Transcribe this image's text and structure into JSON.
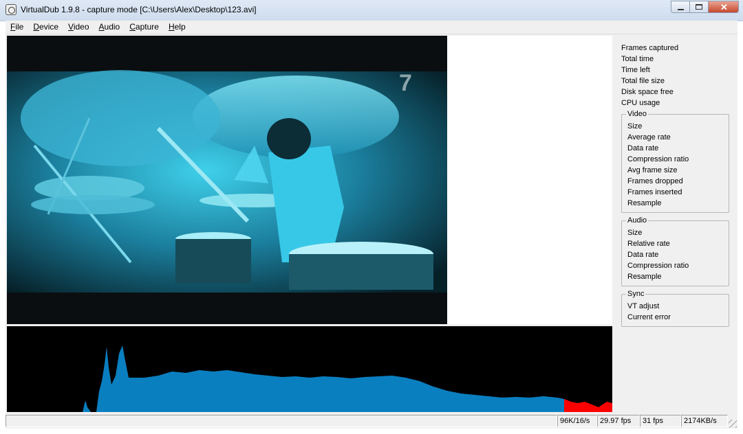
{
  "window": {
    "title": "VirtualDub 1.9.8 - capture mode [C:\\Users\\Alex\\Desktop\\123.avi]"
  },
  "menu": [
    {
      "label": "File",
      "accel": "F",
      "rest": "ile"
    },
    {
      "label": "Device",
      "accel": "D",
      "rest": "evice"
    },
    {
      "label": "Video",
      "accel": "V",
      "rest": "ideo"
    },
    {
      "label": "Audio",
      "accel": "A",
      "rest": "udio"
    },
    {
      "label": "Capture",
      "accel": "C",
      "rest": "apture"
    },
    {
      "label": "Help",
      "accel": "H",
      "rest": "elp"
    }
  ],
  "stats": {
    "general": [
      "Frames captured",
      "Total time",
      "Time left",
      "Total file size",
      "Disk space free",
      "CPU usage"
    ],
    "video": {
      "title": "Video",
      "items": [
        "Size",
        "Average rate",
        "Data rate",
        "Compression ratio",
        "Avg frame size",
        "Frames dropped",
        "Frames inserted",
        "Resample"
      ]
    },
    "audio": {
      "title": "Audio",
      "items": [
        "Size",
        "Relative rate",
        "Data rate",
        "Compression ratio",
        "Resample"
      ]
    },
    "sync": {
      "title": "Sync",
      "items": [
        "VT adjust",
        "Current error"
      ]
    }
  },
  "status": {
    "audio_format": "96K/16/s",
    "target_fps": "29.97 fps",
    "actual_fps": "31 fps",
    "data_rate": "2174KB/s"
  },
  "colors": {
    "histogram_fill": "#0a7fc0",
    "histogram_clip": "#ff0000",
    "video_tint": "#33bde0"
  },
  "icons": {
    "app": "film-reel-icon",
    "minimize": "minimize-icon",
    "maximize": "maximize-icon",
    "close": "close-icon",
    "grip": "resize-grip-icon"
  }
}
